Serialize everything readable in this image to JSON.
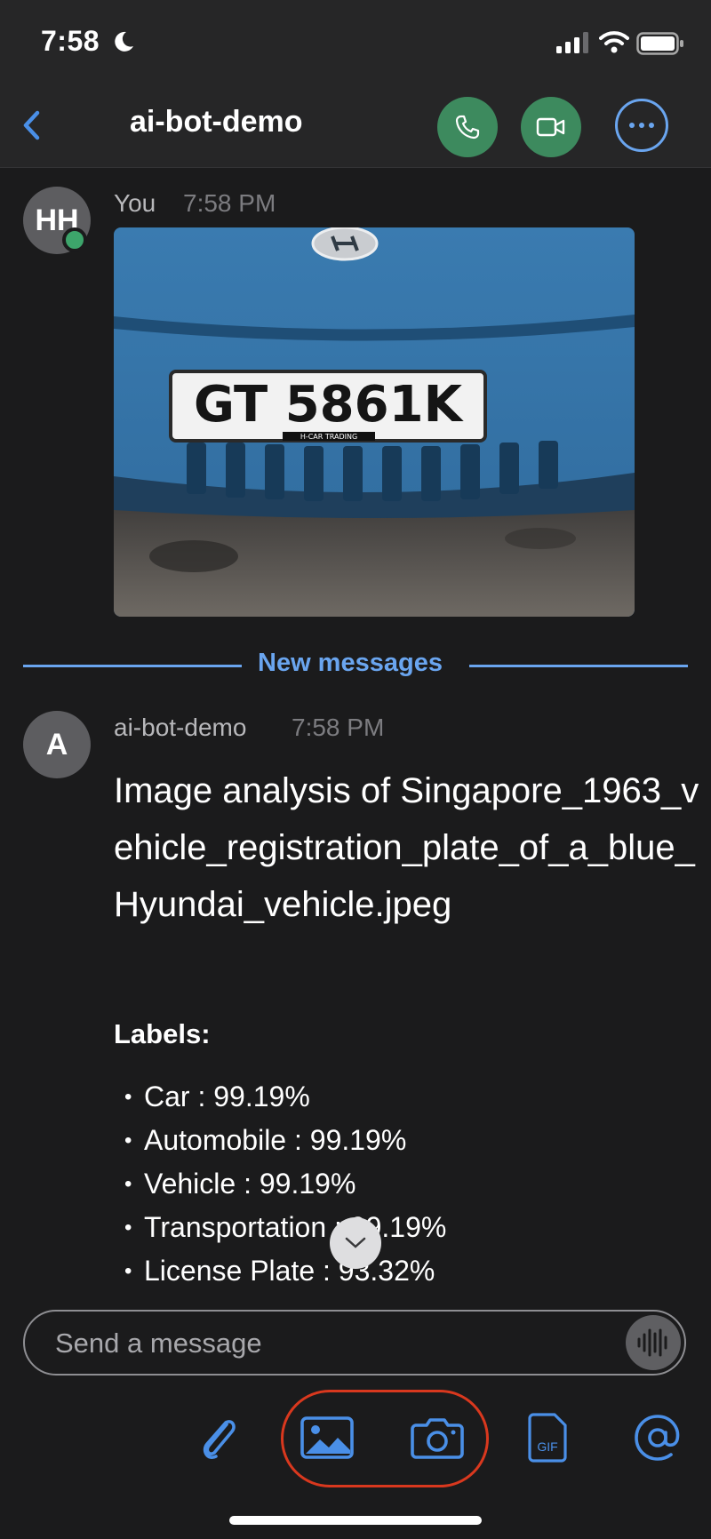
{
  "status_bar": {
    "time": "7:58"
  },
  "header": {
    "title": "ai-bot-demo"
  },
  "messages": [
    {
      "avatar_initials": "HH",
      "sender": "You",
      "time": "7:58 PM",
      "plate_text": "GT 5861K",
      "plate_caption": "H-CAR TRADING"
    },
    {
      "avatar_initials": "A",
      "sender": "ai-bot-demo",
      "time": "7:58 PM",
      "text": "Image analysis of Singapore_1963_vehicle_registration_plate_of_a_blue_Hyundai_vehicle.jpeg",
      "labels_title": "Labels:",
      "labels": [
        "Car : 99.19%",
        "Automobile : 99.19%",
        "Vehicle : 99.19%",
        "Transportation : 99.19%",
        "License Plate : 93.32%"
      ]
    }
  ],
  "divider_label": "New messages",
  "composer": {
    "placeholder": "Send a message"
  },
  "toolbar": {
    "gif_label": "GIF"
  },
  "colors": {
    "accent": "#6aa5ef",
    "call_green": "#3d8a5e",
    "online": "#3da56b",
    "highlight": "#d9381e"
  }
}
